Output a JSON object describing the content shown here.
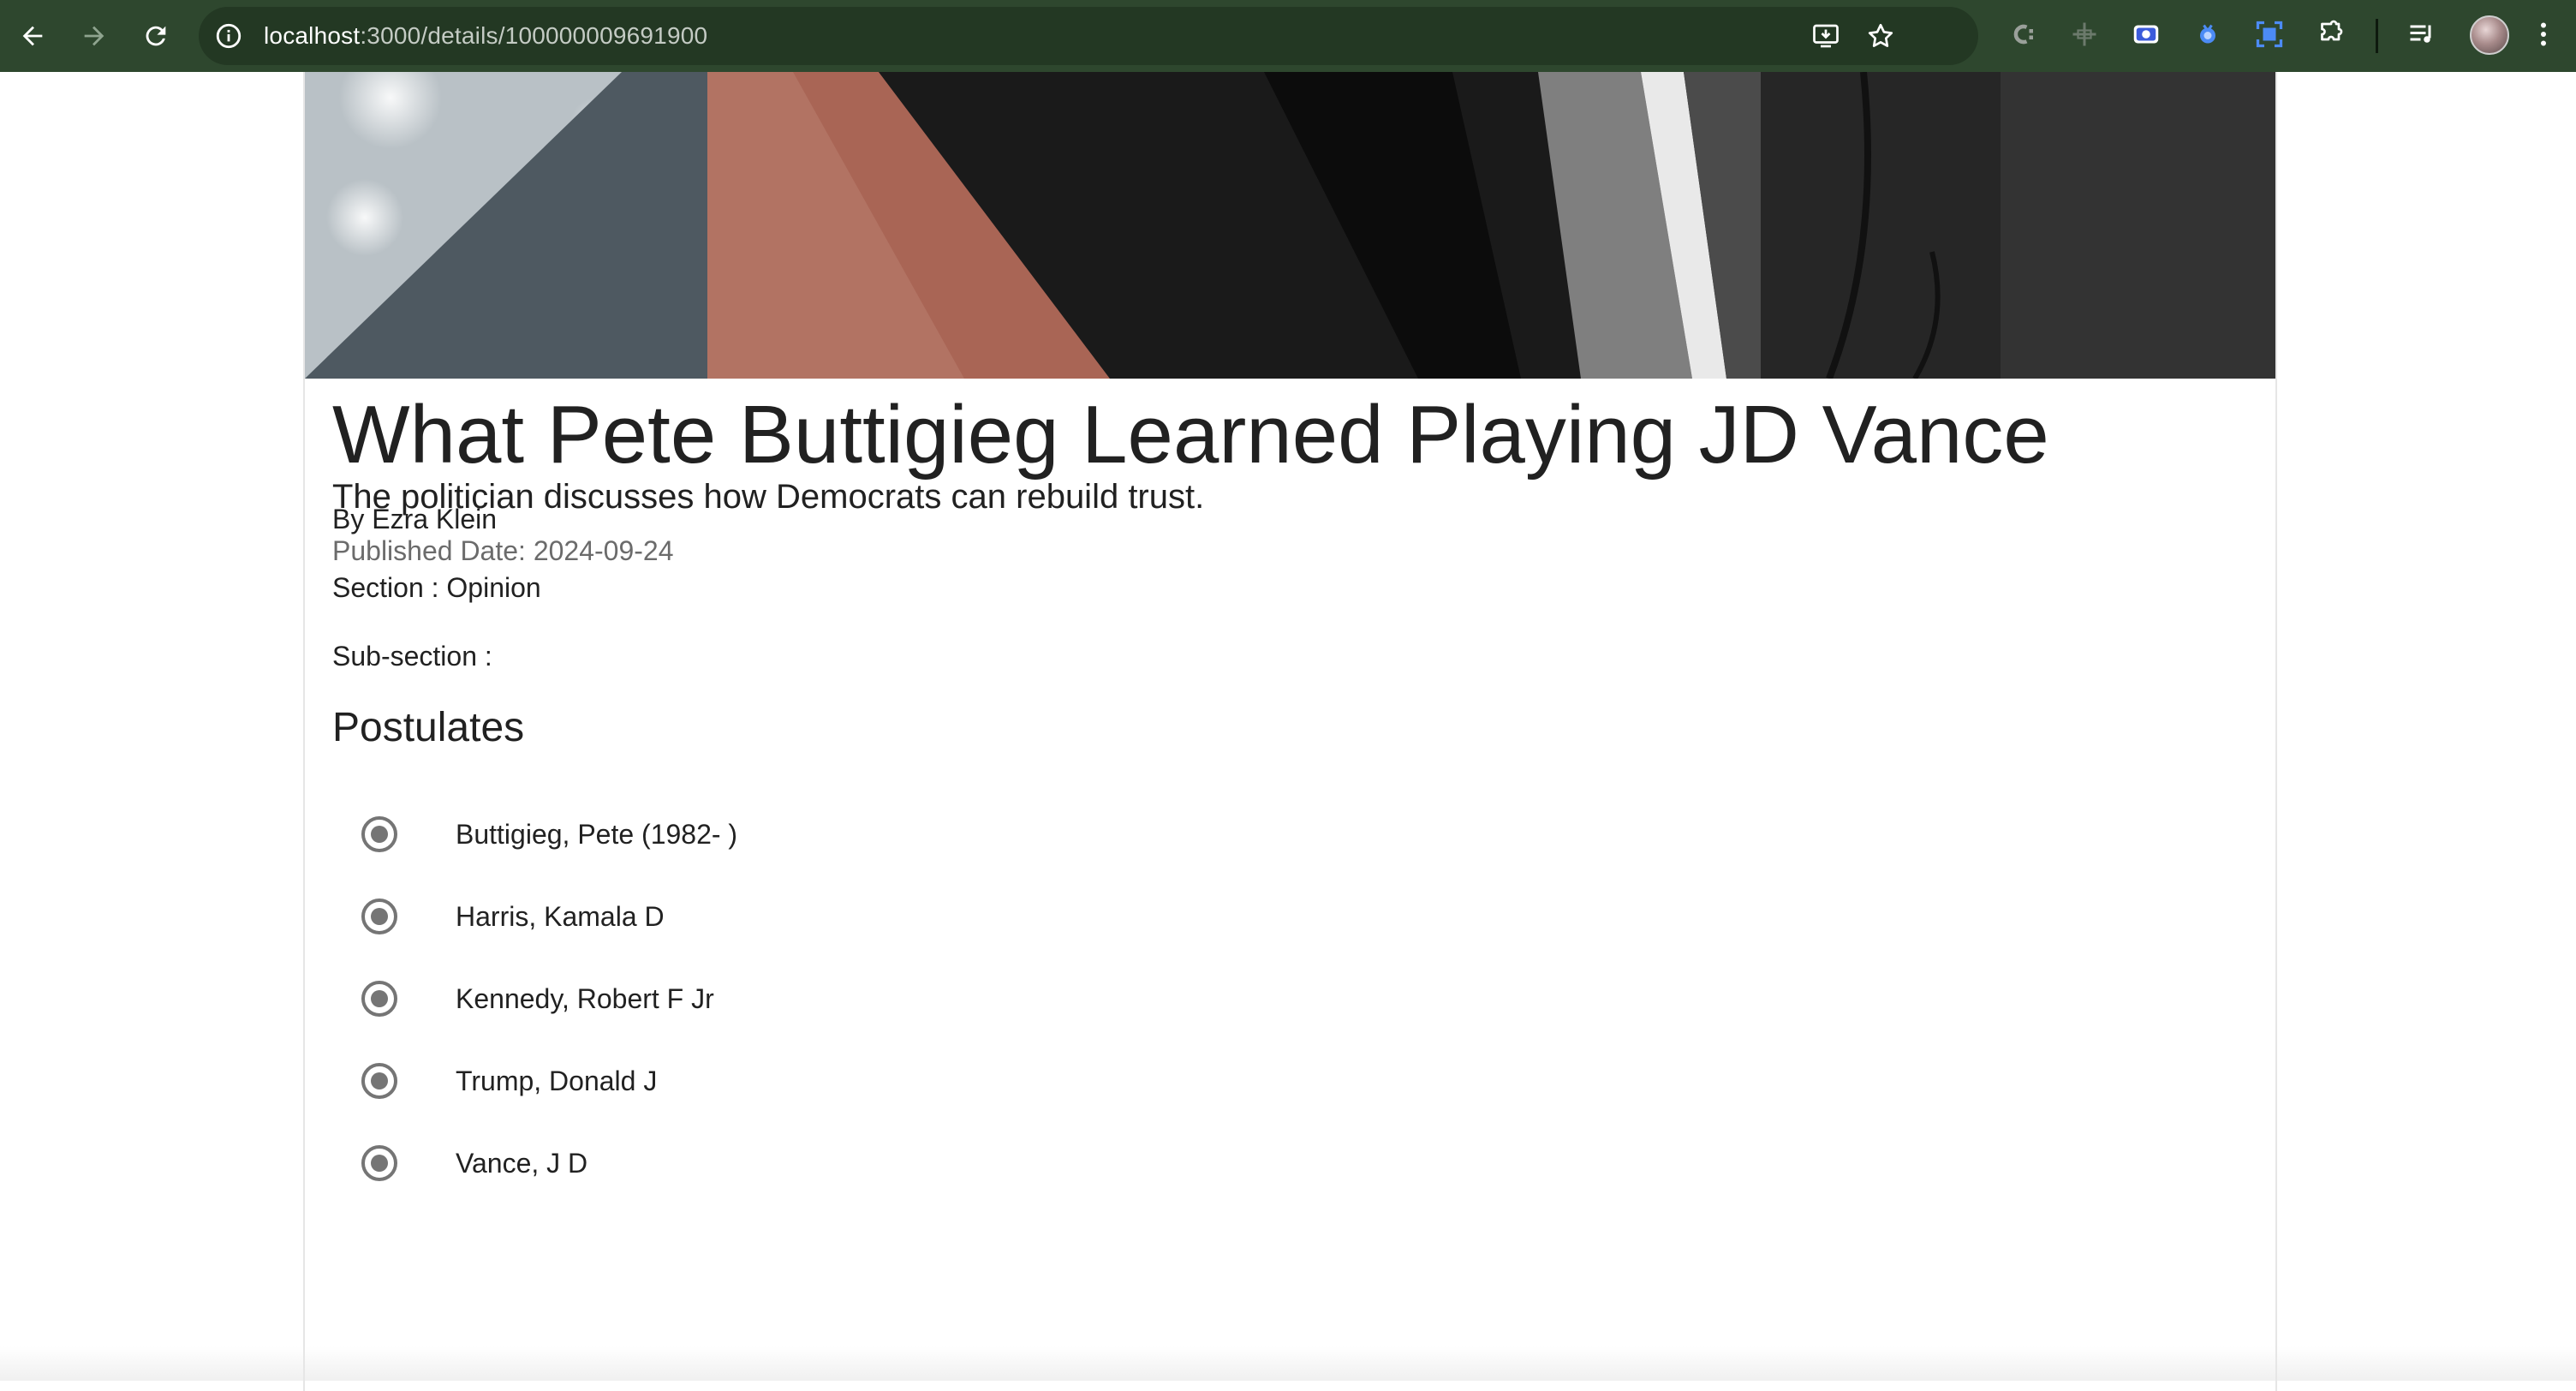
{
  "browser": {
    "url_host": "localhost",
    "url_path": ":3000/details/100000009691900"
  },
  "article": {
    "title": "What Pete Buttigieg Learned Playing JD Vance",
    "subtitle": "The politician discusses how Democrats can rebuild trust.",
    "published_date": "Published Date: 2024-09-24",
    "byline": "By Ezra Klein",
    "section": "Section : Opinion",
    "subsection": "Sub-section :",
    "postulates_heading": "Postulates",
    "postulates": [
      {
        "label": "Buttigieg, Pete (1982- )"
      },
      {
        "label": "Harris, Kamala D"
      },
      {
        "label": "Kennedy, Robert F Jr"
      },
      {
        "label": "Trump, Donald J"
      },
      {
        "label": "Vance, J D"
      }
    ]
  },
  "icons": {
    "back": "arrow-left-icon",
    "forward": "arrow-right-icon",
    "reload": "reload-icon",
    "site_info": "info-icon",
    "install": "install-app-icon",
    "bookmark": "star-icon",
    "extensions": "puzzle-icon",
    "media": "media-control-icon",
    "menu": "kebab-menu-icon"
  },
  "colors": {
    "toolbar": "#2e472e",
    "omnibox": "#233823",
    "radio": "#757575"
  }
}
